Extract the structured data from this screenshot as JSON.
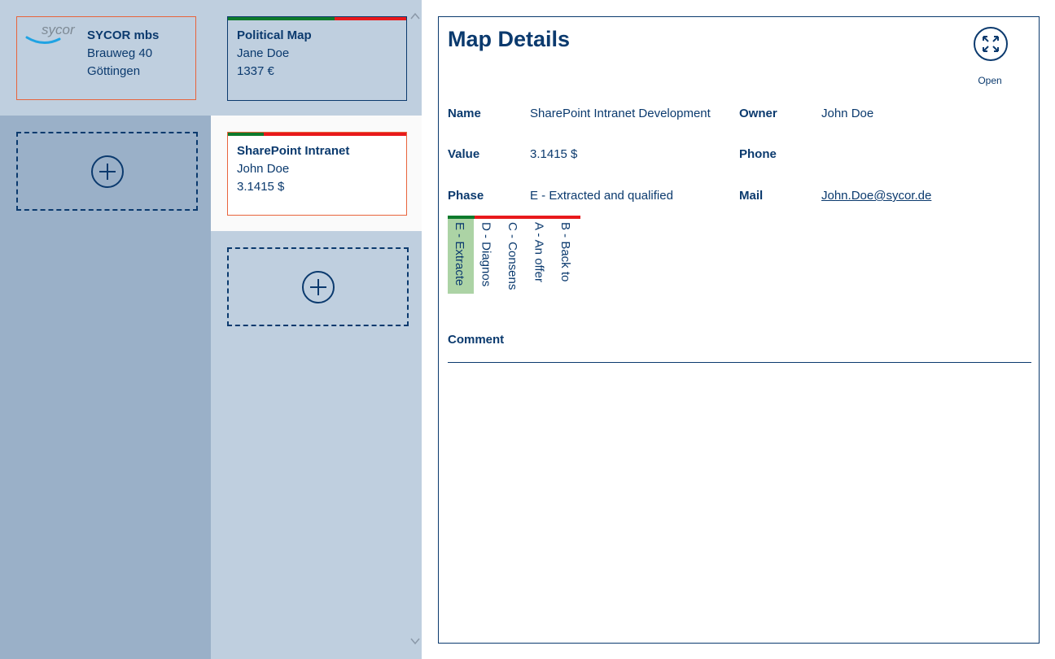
{
  "account_card": {
    "logo_text": "sycor",
    "name": "SYCOR mbs",
    "street": "Brauweg 40",
    "city": "Göttingen"
  },
  "map_cards": [
    {
      "title": "Political Map",
      "owner": "Jane Doe",
      "value": "1337 €",
      "progress": 0.6
    },
    {
      "title": "SharePoint Intranet",
      "owner": "John Doe",
      "value": "3.1415 $",
      "progress": 0.2
    }
  ],
  "colors": {
    "progress_done": "#0e7a2c",
    "progress_todo": "#e8191c",
    "accent": "#0b3a6e",
    "selected_border": "#e8643c",
    "phase_current": "#acd3a5"
  },
  "icons": {
    "add": "plus-circle-icon",
    "open": "expand-arrows-icon",
    "scroll_up": "chevron-up-icon",
    "scroll_down": "chevron-down-icon"
  },
  "details": {
    "title": "Map Details",
    "open_label": "Open",
    "labels": {
      "name": "Name",
      "value": "Value",
      "phase": "Phase",
      "owner": "Owner",
      "phone": "Phone",
      "mail": "Mail",
      "comment": "Comment"
    },
    "name": "SharePoint Intranet Development",
    "value": "3.1415 $",
    "phase": "E - Extracted and qualified",
    "owner": "John Doe",
    "phone": "",
    "mail": "John.Doe@sycor.de",
    "comment": ""
  },
  "phases": [
    {
      "label": "E - Extracte",
      "current": true
    },
    {
      "label": "D - Diagnos",
      "current": false
    },
    {
      "label": "C - Consens",
      "current": false
    },
    {
      "label": "A - An offer",
      "current": false
    },
    {
      "label": "B - Back to",
      "current": false
    }
  ]
}
